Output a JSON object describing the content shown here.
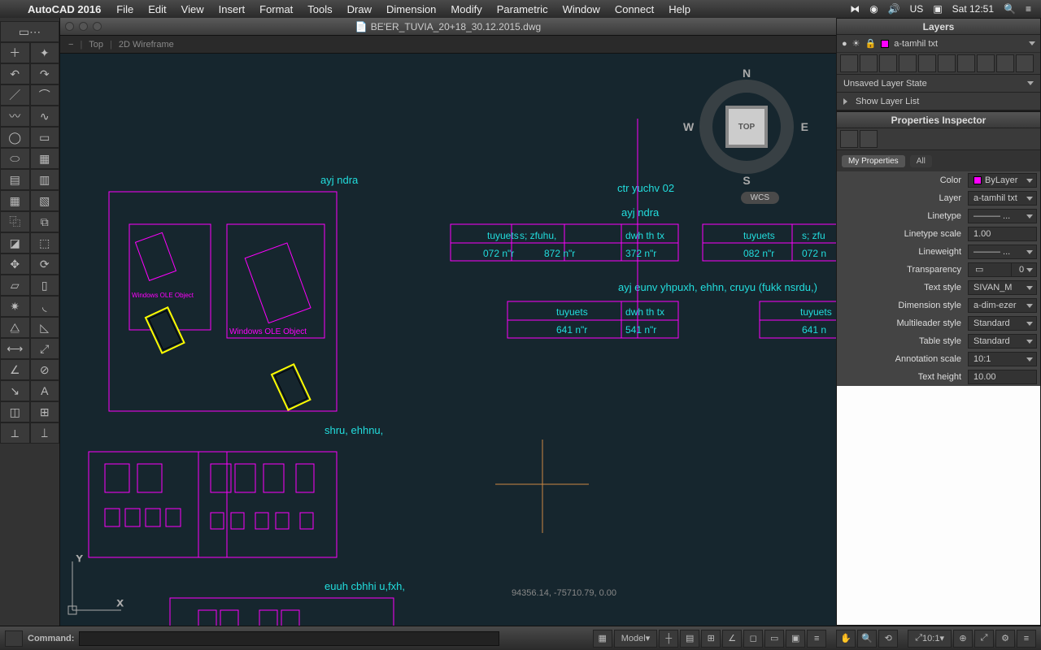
{
  "app_name": "AutoCAD 2016",
  "menubar": [
    "File",
    "Edit",
    "View",
    "Insert",
    "Format",
    "Tools",
    "Draw",
    "Dimension",
    "Modify",
    "Parametric",
    "Window",
    "Connect",
    "Help"
  ],
  "menubar_right": {
    "input": "US",
    "time": "Sat 12:51"
  },
  "doc_title": "BE'ER_TUVIA_20+18_30.12.2015.dwg",
  "viewbar": {
    "minus": "−",
    "top": "Top",
    "mode": "2D Wireframe"
  },
  "viewcube": {
    "face": "TOP",
    "n": "N",
    "e": "E",
    "s": "S",
    "w": "W"
  },
  "wcs": "WCS",
  "canvas_labels": {
    "top_left": "ayj ndra",
    "ole1": "Windows OLE Object",
    "ole2": "Windows OLE Object",
    "mid": "shru, ehhnu,",
    "bottom": "euuh cbhhi u,fxh,",
    "right_ctr": "ctr yuchv 02",
    "right_ayj": "ayj ndra",
    "right_long": "ayj eunv yhpuxh, ehhn, cruyu (fukk nsrdu,)"
  },
  "table_upper": {
    "row1": [
      "tuyuets",
      "s; zfuhu,",
      "dwh th tx",
      "",
      "tuyuets",
      "s; zfu"
    ],
    "row2": [
      "072 n\"r",
      "872 n\"r",
      "372 n\"r",
      "",
      "082 n\"r",
      "072 n"
    ]
  },
  "table_lower": {
    "row1": [
      "tuyuets",
      "dwh th tx",
      "",
      "tuyuets"
    ],
    "row2": [
      "641 n\"r",
      "541 n\"r",
      "",
      "641 n"
    ]
  },
  "coords": "94356.14, -75710.79, 0.00",
  "layers_panel": {
    "title": "Layers",
    "current": "a-tamhil txt",
    "state": "Unsaved Layer State",
    "show_list": "Show Layer List"
  },
  "props_panel": {
    "title": "Properties Inspector",
    "tabs": {
      "mine": "My Properties",
      "all": "All"
    },
    "rows": [
      {
        "label": "Color",
        "value": "ByLayer",
        "swatch": true
      },
      {
        "label": "Layer",
        "value": "a-tamhil txt"
      },
      {
        "label": "Linetype",
        "value": "———  ..."
      },
      {
        "label": "Linetype scale",
        "value": "1.00"
      },
      {
        "label": "Lineweight",
        "value": "———  ..."
      },
      {
        "label": "Transparency",
        "value": "0"
      },
      {
        "label": "Text style",
        "value": "SIVAN_M"
      },
      {
        "label": "Dimension style",
        "value": "a-dim-ezer"
      },
      {
        "label": "Multileader style",
        "value": "Standard"
      },
      {
        "label": "Table style",
        "value": "Standard"
      },
      {
        "label": "Annotation scale",
        "value": "10:1"
      },
      {
        "label": "Text height",
        "value": "10.00"
      }
    ]
  },
  "statusbar": {
    "command": "Command:",
    "model": "Model",
    "anno_scale": "10:1"
  }
}
